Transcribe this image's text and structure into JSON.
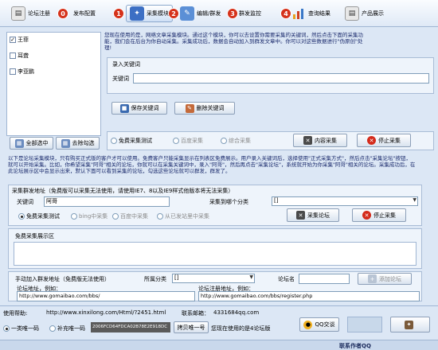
{
  "toolbar": {
    "items": [
      {
        "label": "论坛注册",
        "step": ""
      },
      {
        "label": "发布配置",
        "step": "0"
      },
      {
        "label": "采集模块",
        "step": "1"
      },
      {
        "label": "编辑/群发",
        "step": "2"
      },
      {
        "label": "群发监控",
        "step": "3"
      },
      {
        "label": "查询结果",
        "step": "4"
      },
      {
        "label": "产品展示",
        "step": ""
      }
    ]
  },
  "keywords_list": [
    "王菲",
    "耳聋",
    "李亚鹏"
  ],
  "top_desc": "您现在使用的是，网络文章采集模块。通过这个模块，你可以去设置你需要采集的关键词，然后点击下面的采集功能，我们会在后台为你自动采集。采集成功后，数据会自动加入到群发文章中。你可以对这些数据进行\"伪原创\"处理!",
  "keyword_entry": {
    "group_title": "录入关键词",
    "label": "关键词",
    "value": ""
  },
  "buttons": {
    "save_keyword": "保存关键词",
    "delete_keyword": "删除关键词",
    "select_all": "全部选中",
    "deselect": "去除勾选",
    "content_collect": "内容采集",
    "stop_collect": "停止采集",
    "forum_collect": "采集论坛",
    "stop_forum_collect": "停止采集",
    "add_forum": "添加论坛",
    "qq_chat": "QQ交谈",
    "copy_code": "拷贝唯一号"
  },
  "collect_modes": [
    "免费采集测试",
    "百度采集",
    "综合采集"
  ],
  "forum_desc": "以下是论坛采集模块，只有购买正式版的客户才可以使用。免费客户只能采集显示在列表区免费展示。用户录入关键词后，选择使用\"正式采集方式\"，然后点击\"采集论坛\"按钮，就可以开始采集。比如，你希望采集\"阿哥\"相关的论坛，你就可以在采集关键词中，录入\"阿哥\"，然后再点击\"采集论坛\"，系统就开始为你采集\"阿哥\"相关的论坛。采集成功后，在此论坛展示区中会显示出来，默认下面可以看到采集的论坛，勾选这些论坛就可以群发，群发了。",
  "forum_group": {
    "title": "采集群发地址（免费版可以采集无法使用，请使用IE7、8以及IE9样式他版本将无法采集）",
    "keyword_label": "关键词",
    "keyword_value": "阿哥",
    "category_label": "采集到哪个分类",
    "category_value": "[]",
    "modes": [
      "免费采集测试",
      "bing中采集",
      "百度中采集",
      "从已发站里中采集"
    ]
  },
  "free_display": {
    "title": "免费采集展示区"
  },
  "manual_add": {
    "title": "手动加入群发地址（免费版无法使用）",
    "category_label": "所属分类",
    "category_value": "[]",
    "forum_name_label": "论坛名",
    "forum_address_label": "论坛地址，例如：",
    "forum_address_example": "http://www.gomaibao.com/bbs/",
    "register_address_label": "论坛注册地址，例如：",
    "register_address_example": "http://www.gomaibao.com/bbs/register.php"
  },
  "footer": {
    "help_label": "使用帮助:",
    "help_url": "http://www.xinxilong.com/Html/?2451.html",
    "contact_label": "联系邮箱：",
    "contact_value": "4331684qq.com",
    "one_machine": "一类唯一码",
    "supplement": "补充唯一码",
    "machine_code": "2006FCD64FDCA02B78E2E918DC",
    "code_hint": "您现在使用的是4论坛版",
    "bottom_author": "联系作者QQ"
  }
}
